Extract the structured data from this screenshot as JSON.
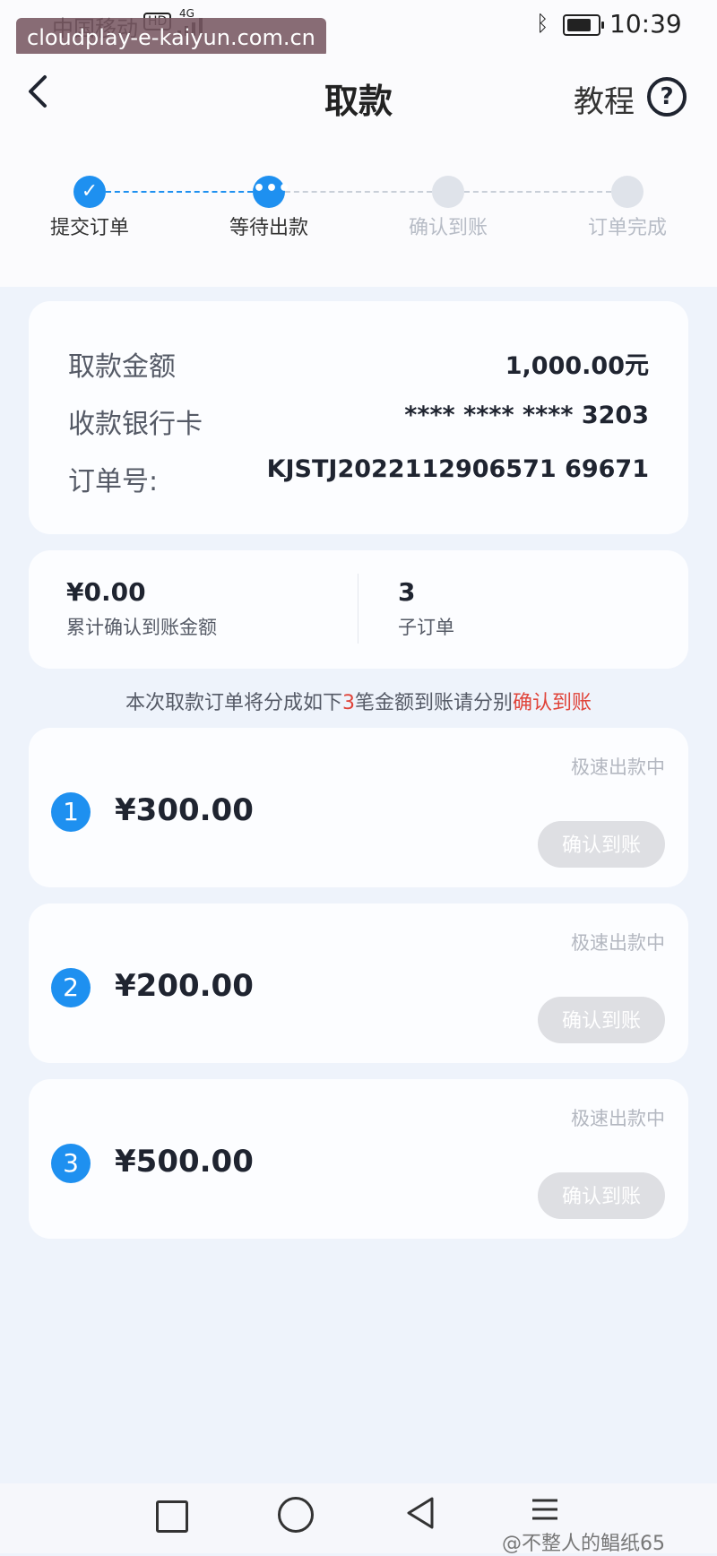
{
  "status_bar": {
    "carrier": "中国移动",
    "hd": "HD",
    "network": "4G",
    "time": "10:39",
    "watermark": "cloudplay-e-kaiyun.com.cn"
  },
  "header": {
    "title": "取款",
    "tutorial_label": "教程",
    "help_symbol": "?"
  },
  "steps": [
    {
      "label": "提交订单",
      "state": "done"
    },
    {
      "label": "等待出款",
      "state": "current"
    },
    {
      "label": "确认到账",
      "state": "pending"
    },
    {
      "label": "订单完成",
      "state": "pending"
    }
  ],
  "details": {
    "amount_label": "取款金额",
    "amount_value": "1,000.00元",
    "card_label": "收款银行卡",
    "card_value": "**** **** **** 3203",
    "order_label": "订单号:",
    "order_value": "KJSTJ2022112906571 69671"
  },
  "summary": {
    "confirmed_amount": "¥0.00",
    "confirmed_label": "累计确认到账金额",
    "sub_orders_count": "3",
    "sub_orders_label": "子订单"
  },
  "notice": {
    "prefix": "本次取款订单将分成如下",
    "count": "3",
    "middle": "笔金额到账请分别",
    "link": "确认到账"
  },
  "sub_orders": [
    {
      "index": "1",
      "amount": "¥300.00",
      "status": "极速出款中",
      "button": "确认到账"
    },
    {
      "index": "2",
      "amount": "¥200.00",
      "status": "极速出款中",
      "button": "确认到账"
    },
    {
      "index": "3",
      "amount": "¥500.00",
      "status": "极速出款中",
      "button": "确认到账"
    }
  ],
  "footer": {
    "source_mark": "@不整人的鲳纸65"
  },
  "colors": {
    "accent": "#1e90f0",
    "highlight_red": "#e0443a",
    "disabled_button": "#dedfe3"
  }
}
